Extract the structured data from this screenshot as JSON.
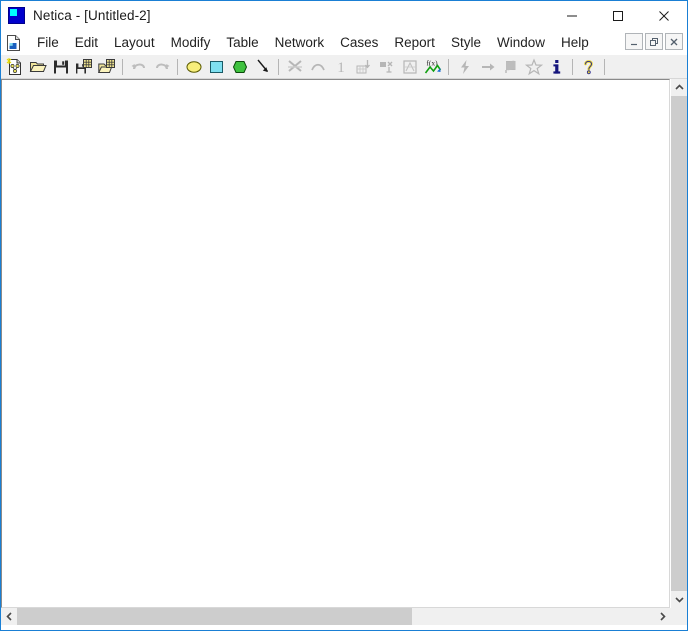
{
  "window": {
    "title": "Netica - [Untitled-2]",
    "app_name": "Netica",
    "document_name": "[Untitled-2]",
    "icon": "netica-logo-icon",
    "controls": [
      {
        "name": "minimize-button",
        "glyph": "minimize-icon",
        "label": "Minimize"
      },
      {
        "name": "maximize-button",
        "glyph": "maximize-icon",
        "label": "Maximize"
      },
      {
        "name": "close-button",
        "glyph": "close-icon",
        "label": "Close"
      }
    ]
  },
  "menubar": {
    "document_icon": "document-icon",
    "items": [
      {
        "label": "File"
      },
      {
        "label": "Edit"
      },
      {
        "label": "Layout"
      },
      {
        "label": "Modify"
      },
      {
        "label": "Table"
      },
      {
        "label": "Network"
      },
      {
        "label": "Cases"
      },
      {
        "label": "Report"
      },
      {
        "label": "Style"
      },
      {
        "label": "Window"
      },
      {
        "label": "Help"
      }
    ],
    "mdi_controls": [
      {
        "name": "mdi-minimize-button",
        "glyph": "mdi-minimize-icon",
        "label": "Minimize Document"
      },
      {
        "name": "mdi-restore-button",
        "glyph": "mdi-restore-icon",
        "label": "Restore Document"
      },
      {
        "name": "mdi-close-button",
        "glyph": "mdi-close-icon",
        "label": "Close Document"
      }
    ]
  },
  "toolbar": {
    "buttons": [
      {
        "name": "new-network-button",
        "icon": "new-document-icon",
        "label": "New Network",
        "enabled": true
      },
      {
        "name": "open-network-button",
        "icon": "open-folder-icon",
        "label": "Open Network",
        "enabled": true
      },
      {
        "name": "save-network-button",
        "icon": "save-floppy-icon",
        "label": "Save Network",
        "enabled": true
      },
      {
        "name": "save-cases-button",
        "icon": "save-cases-icon",
        "label": "Save Cases",
        "enabled": true
      },
      {
        "name": "open-cases-button",
        "icon": "open-cases-icon",
        "label": "Open Cases",
        "enabled": true
      },
      {
        "name": "separator-1",
        "icon": "separator",
        "label": "",
        "enabled": true
      },
      {
        "name": "undo-button",
        "icon": "undo-arrow-icon",
        "label": "Undo",
        "enabled": false
      },
      {
        "name": "redo-button",
        "icon": "redo-arrow-icon",
        "label": "Redo",
        "enabled": false
      },
      {
        "name": "separator-2",
        "icon": "separator",
        "label": "",
        "enabled": true
      },
      {
        "name": "nature-node-tool",
        "icon": "yellow-ellipse-icon",
        "label": "Nature Node",
        "enabled": true
      },
      {
        "name": "decision-node-tool",
        "icon": "cyan-square-icon",
        "label": "Decision Node",
        "enabled": true
      },
      {
        "name": "utility-node-tool",
        "icon": "green-hexagon-icon",
        "label": "Utility Node",
        "enabled": true
      },
      {
        "name": "select-arrow-tool",
        "icon": "arrow-pointer-icon",
        "label": "Select",
        "enabled": true
      },
      {
        "name": "separator-3",
        "icon": "separator",
        "label": "",
        "enabled": true
      },
      {
        "name": "cut-links-button",
        "icon": "cut-links-icon",
        "label": "Cut Links",
        "enabled": false
      },
      {
        "name": "add-link-button",
        "icon": "link-arc-icon",
        "label": "Add Link",
        "enabled": false
      },
      {
        "name": "number-one-button",
        "icon": "digit-one-icon",
        "label": "Single Case",
        "enabled": false
      },
      {
        "name": "learn-table-button",
        "icon": "learn-table-icon",
        "label": "Learn From Cases",
        "enabled": false
      },
      {
        "name": "node-sets-button",
        "icon": "node-sets-icon",
        "label": "Node Sets",
        "enabled": false
      },
      {
        "name": "sensitivity-button",
        "icon": "sensitivity-icon",
        "label": "Sensitivity",
        "enabled": false
      },
      {
        "name": "equation-button",
        "icon": "fx-equation-icon",
        "label": "Equation",
        "enabled": true
      },
      {
        "name": "separator-4",
        "icon": "separator",
        "label": "",
        "enabled": true
      },
      {
        "name": "compile-button",
        "icon": "lightning-bolt-icon",
        "label": "Compile Network",
        "enabled": false
      },
      {
        "name": "propagate-button",
        "icon": "right-arrow-icon",
        "label": "Propagate Findings",
        "enabled": false
      },
      {
        "name": "findings-button",
        "icon": "findings-flag-icon",
        "label": "Enter Findings",
        "enabled": false
      },
      {
        "name": "clear-findings-button",
        "icon": "clear-star-icon",
        "label": "Clear Findings",
        "enabled": false
      },
      {
        "name": "info-button",
        "icon": "info-i-icon",
        "label": "Information",
        "enabled": true
      },
      {
        "name": "separator-5",
        "icon": "separator",
        "label": "",
        "enabled": true
      },
      {
        "name": "help-button",
        "icon": "help-question-icon",
        "label": "Help",
        "enabled": true
      },
      {
        "name": "separator-6",
        "icon": "separator",
        "label": "",
        "enabled": true
      }
    ]
  },
  "canvas": {
    "name": "network-canvas",
    "background": "#ffffff",
    "content": ""
  },
  "scrollbars": {
    "vertical": {
      "up_arrow": "scroll-up-icon",
      "down_arrow": "scroll-down-icon",
      "thumb_visible": false
    },
    "horizontal": {
      "left_arrow": "scroll-left-icon",
      "right_arrow": "scroll-right-icon",
      "thumb_left_pct": 0,
      "thumb_width_pct": 62
    }
  },
  "colors": {
    "accent_border": "#1a7fd4",
    "toolbar_bg": "#f0f0f0",
    "canvas_bg": "#ffffff",
    "nature_node": "#f7ee7b",
    "decision_node": "#7fe0f0",
    "utility_node": "#3fc23f",
    "disabled_icon": "#b0b0b0",
    "info_blue": "#1c1c8c"
  }
}
